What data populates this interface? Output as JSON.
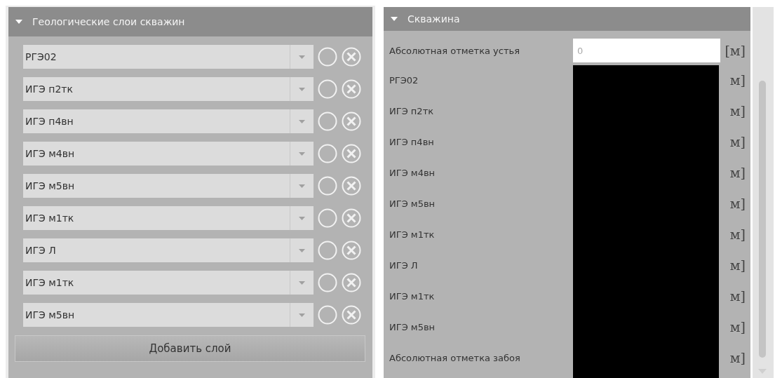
{
  "layers_panel": {
    "title": "Геологические слои скважин",
    "expanded": true,
    "layers": [
      {
        "name": "РГЭ02"
      },
      {
        "name": "ИГЭ п2тк"
      },
      {
        "name": "ИГЭ п4вн"
      },
      {
        "name": "ИГЭ м4вн"
      },
      {
        "name": "ИГЭ м5вн"
      },
      {
        "name": "ИГЭ м1тк"
      },
      {
        "name": "ИГЭ Л"
      },
      {
        "name": "ИГЭ м1тк"
      },
      {
        "name": "ИГЭ м5вн"
      }
    ],
    "add_button": "Добавить слой"
  },
  "well_panel": {
    "title": "Скважина",
    "expanded": true,
    "rows": [
      {
        "kind": "input",
        "label": "Абсолютная отметка устья",
        "value": "0",
        "unit": "[м]"
      },
      {
        "kind": "redacted",
        "label": "РГЭ02",
        "unit": "м]"
      },
      {
        "kind": "redacted",
        "label": "ИГЭ п2тк",
        "unit": "м]"
      },
      {
        "kind": "redacted",
        "label": "ИГЭ п4вн",
        "unit": "м]"
      },
      {
        "kind": "redacted",
        "label": "ИГЭ м4вн",
        "unit": "м]"
      },
      {
        "kind": "redacted",
        "label": "ИГЭ м5вн",
        "unit": "м]"
      },
      {
        "kind": "redacted",
        "label": "ИГЭ м1тк",
        "unit": "м]"
      },
      {
        "kind": "redacted",
        "label": "ИГЭ Л",
        "unit": "м]"
      },
      {
        "kind": "redacted",
        "label": "ИГЭ м1тк",
        "unit": "м]"
      },
      {
        "kind": "redacted",
        "label": "ИГЭ м5вн",
        "unit": "м]"
      },
      {
        "kind": "redacted",
        "label": "Абсолютная отметка забоя",
        "unit": "м]"
      }
    ]
  }
}
